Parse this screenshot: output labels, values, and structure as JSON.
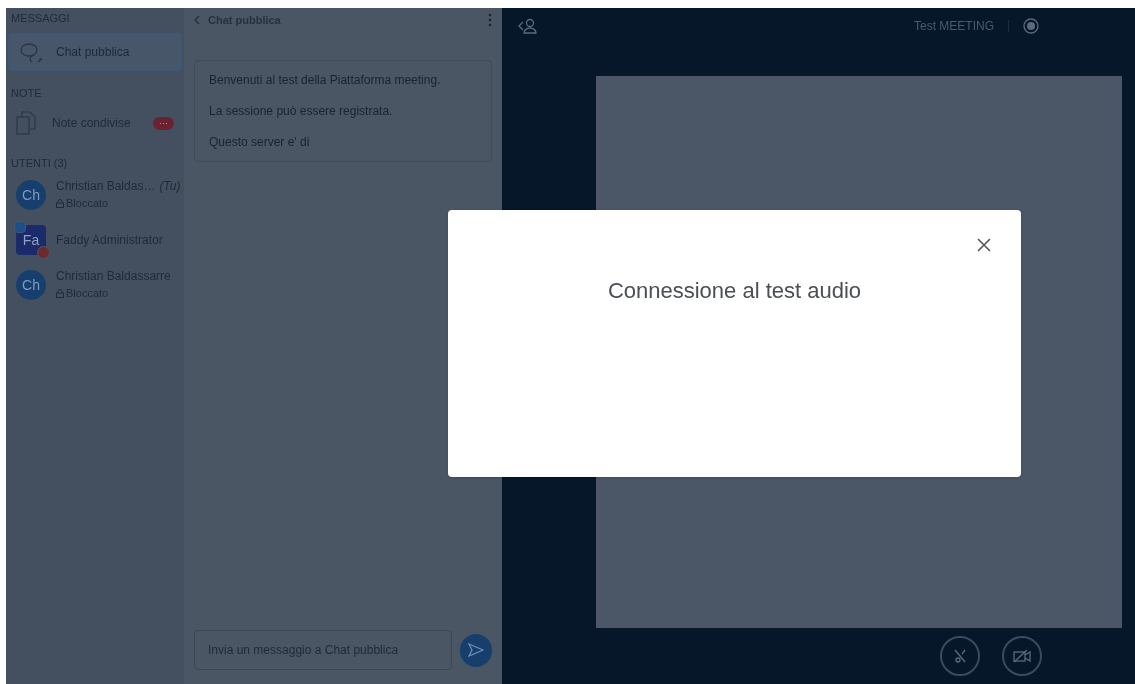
{
  "sidebar": {
    "messages_heading": "MESSAGGI",
    "chats": [
      {
        "label": "Chat pubblica",
        "selected": true
      }
    ],
    "notes_heading": "NOTE",
    "notes": [
      {
        "label": "Note condivise",
        "badge": "···"
      }
    ],
    "users_heading": "UTENTI (3)",
    "users": [
      {
        "initials": "Ch",
        "name": "Christian Baldas…",
        "you_label": "(Tu)",
        "status": "Bloccato",
        "kind": "circle"
      },
      {
        "initials": "Fa",
        "name": "Faddy Administrator",
        "kind": "square"
      },
      {
        "initials": "Ch",
        "name": "Christian Baldassarre",
        "status": "Bloccato",
        "kind": "circle"
      }
    ]
  },
  "chat": {
    "title": "Chat pubblica",
    "welcome": [
      "Benvenuti al test della Piattaforma meeting.",
      "La sessione può essere registrata.",
      "Questo server e' di"
    ],
    "input": {
      "placeholder": "Invia un messaggio a Chat pubblica"
    }
  },
  "meeting": {
    "title": "Test MEETING"
  },
  "modal": {
    "title": "Connessione al test audio"
  }
}
